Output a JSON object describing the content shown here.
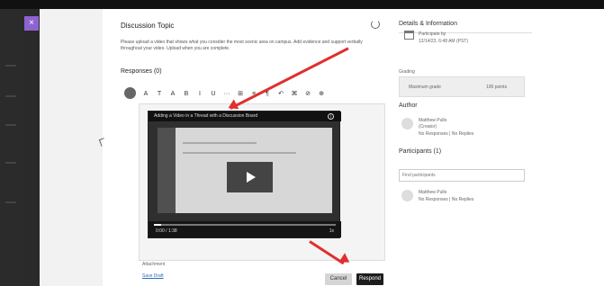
{
  "discussion": {
    "title": "Discussion Topic",
    "description": "Please upload a video that shows what you consider the most scenic area on campus. Add evidence and support verbally throughout your video. Upload when you are complete.",
    "responses_label": "Responses (0)"
  },
  "toolbar": {
    "items": [
      "A",
      "T",
      "A",
      "B",
      "I",
      "U",
      "···",
      "⊞",
      "≡",
      "¶",
      "↶",
      "⌘",
      "⊘",
      "⊕"
    ]
  },
  "video": {
    "title": "Adding a Video in a Thread with a Discussion Board",
    "time": "0:00 / 1:38",
    "speed": "1x"
  },
  "editor": {
    "attachment_label": "Attachment",
    "save_draft": "Save Draft",
    "cancel": "Cancel",
    "respond": "Respond"
  },
  "details": {
    "title": "Details & Information",
    "participate_by": "Participate by",
    "date": "12/14/23, 6:48 AM (PST)",
    "grading": "Grading",
    "max_grade": "Maximum grade",
    "points": "100 points"
  },
  "author": {
    "title": "Author",
    "name": "Matthew Pullo",
    "role": "(Creator)",
    "stats": "No Responses | No Replies"
  },
  "participants": {
    "title": "Participants (1)",
    "search_placeholder": "Find participants",
    "name": "Matthew Pullo",
    "stats": "No Responses | No Replies"
  },
  "colors": {
    "accent": "#8e63d1",
    "arrow": "#e02f2f",
    "link": "#2b6fb6"
  }
}
